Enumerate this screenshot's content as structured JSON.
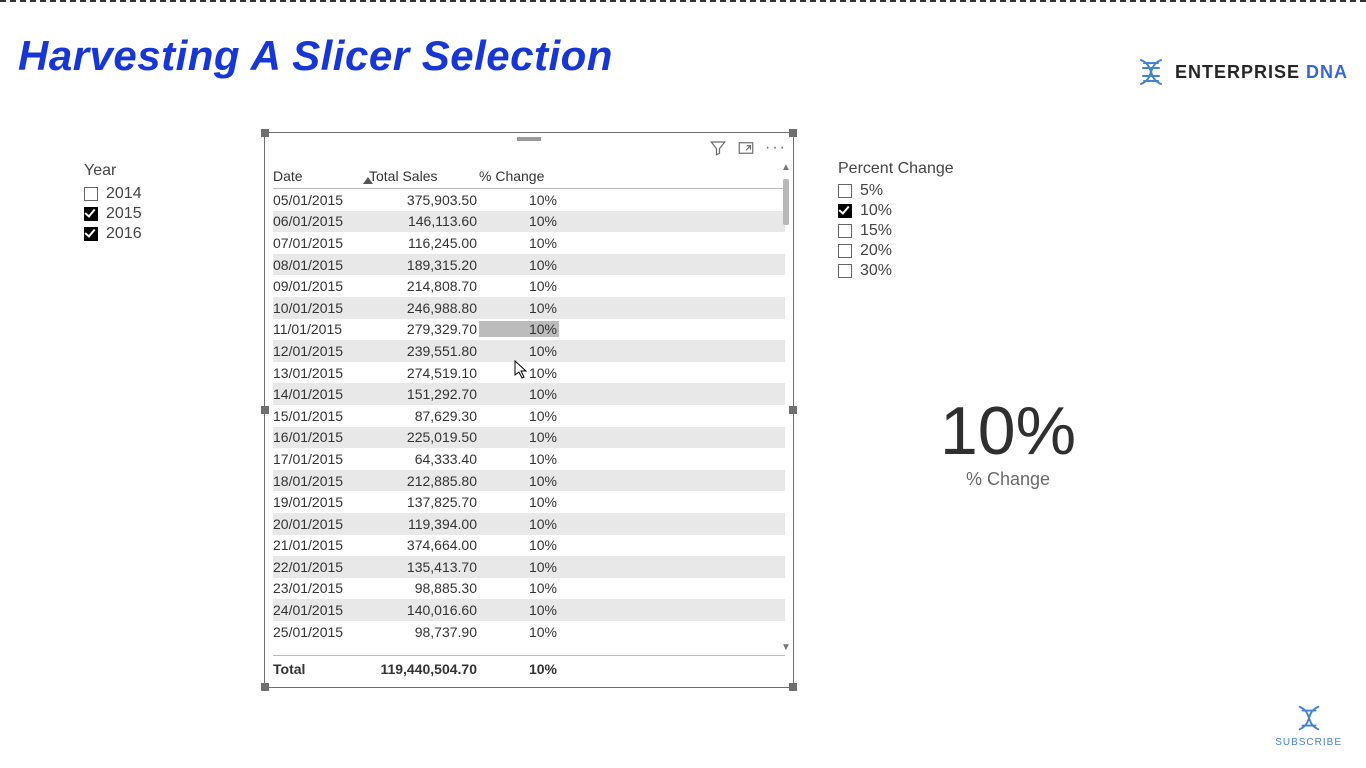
{
  "title": "Harvesting A Slicer Selection",
  "brand": {
    "name": "ENTERPRISE",
    "suffix": "DNA"
  },
  "subscribe_label": "SUBSCRIBE",
  "year_slicer": {
    "title": "Year",
    "items": [
      {
        "label": "2014",
        "checked": false
      },
      {
        "label": "2015",
        "checked": true
      },
      {
        "label": "2016",
        "checked": true
      }
    ]
  },
  "pct_slicer": {
    "title": "Percent Change",
    "items": [
      {
        "label": "5%",
        "checked": false
      },
      {
        "label": "10%",
        "checked": true
      },
      {
        "label": "15%",
        "checked": false
      },
      {
        "label": "20%",
        "checked": false
      },
      {
        "label": "30%",
        "checked": false
      }
    ]
  },
  "card": {
    "value": "10%",
    "label": "% Change"
  },
  "table": {
    "columns": [
      "Date",
      "Total Sales",
      "% Change"
    ],
    "rows": [
      {
        "date": "05/01/2015",
        "sales": "375,903.50",
        "pct": "10%"
      },
      {
        "date": "06/01/2015",
        "sales": "146,113.60",
        "pct": "10%"
      },
      {
        "date": "07/01/2015",
        "sales": "116,245.00",
        "pct": "10%"
      },
      {
        "date": "08/01/2015",
        "sales": "189,315.20",
        "pct": "10%"
      },
      {
        "date": "09/01/2015",
        "sales": "214,808.70",
        "pct": "10%"
      },
      {
        "date": "10/01/2015",
        "sales": "246,988.80",
        "pct": "10%"
      },
      {
        "date": "11/01/2015",
        "sales": "279,329.70",
        "pct": "10%",
        "highlight": true
      },
      {
        "date": "12/01/2015",
        "sales": "239,551.80",
        "pct": "10%"
      },
      {
        "date": "13/01/2015",
        "sales": "274,519.10",
        "pct": "10%"
      },
      {
        "date": "14/01/2015",
        "sales": "151,292.70",
        "pct": "10%"
      },
      {
        "date": "15/01/2015",
        "sales": "87,629.30",
        "pct": "10%"
      },
      {
        "date": "16/01/2015",
        "sales": "225,019.50",
        "pct": "10%"
      },
      {
        "date": "17/01/2015",
        "sales": "64,333.40",
        "pct": "10%"
      },
      {
        "date": "18/01/2015",
        "sales": "212,885.80",
        "pct": "10%"
      },
      {
        "date": "19/01/2015",
        "sales": "137,825.70",
        "pct": "10%"
      },
      {
        "date": "20/01/2015",
        "sales": "119,394.00",
        "pct": "10%"
      },
      {
        "date": "21/01/2015",
        "sales": "374,664.00",
        "pct": "10%"
      },
      {
        "date": "22/01/2015",
        "sales": "135,413.70",
        "pct": "10%"
      },
      {
        "date": "23/01/2015",
        "sales": "98,885.30",
        "pct": "10%"
      },
      {
        "date": "24/01/2015",
        "sales": "140,016.60",
        "pct": "10%"
      },
      {
        "date": "25/01/2015",
        "sales": "98,737.90",
        "pct": "10%"
      }
    ],
    "total": {
      "label": "Total",
      "sales": "119,440,504.70",
      "pct": "10%"
    }
  }
}
